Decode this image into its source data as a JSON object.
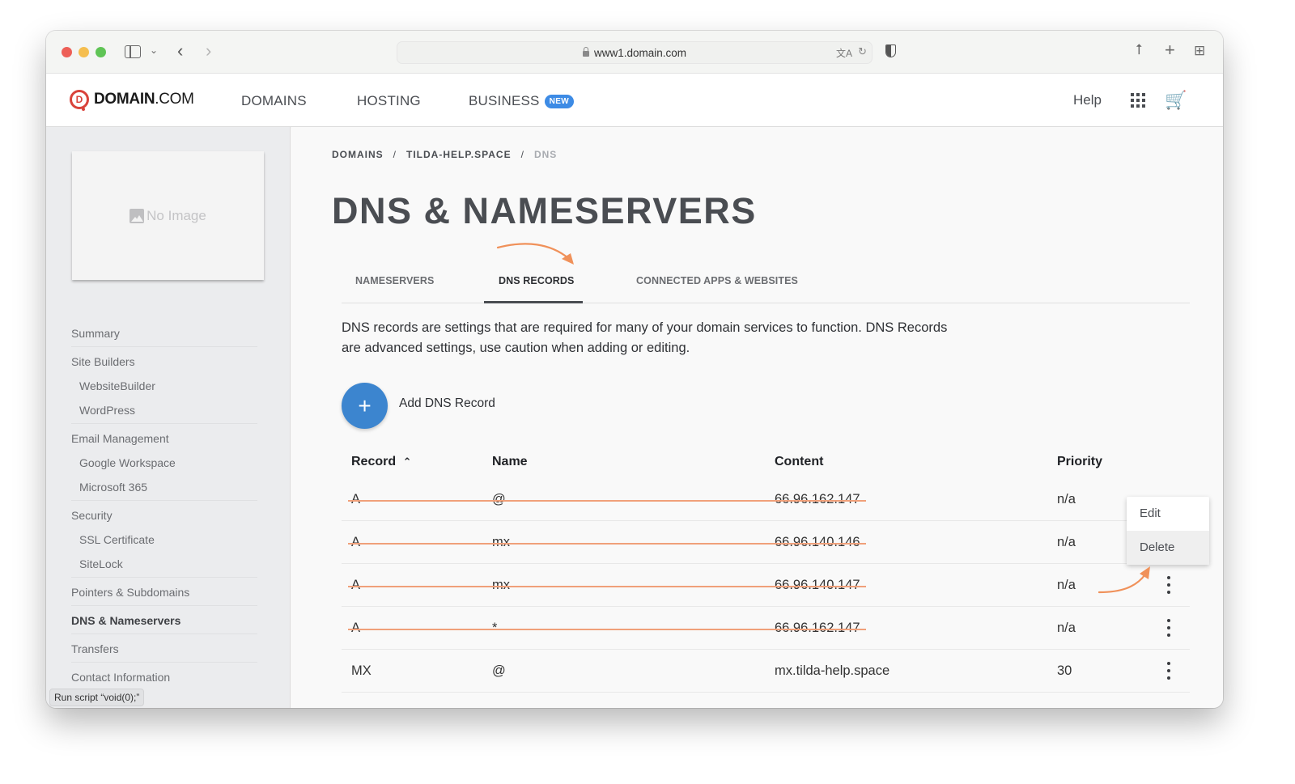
{
  "browser": {
    "url": "www1.domain.com",
    "icons": [
      "sidebar-icon",
      "chevron-down-icon",
      "back-icon",
      "forward-icon",
      "lock-icon",
      "translate-icon",
      "reload-icon",
      "privacy-shield-icon",
      "share-icon",
      "new-tab-icon",
      "tab-overview-icon"
    ]
  },
  "header": {
    "logo_bold": "DOMAIN",
    "logo_light": ".COM",
    "logo_mark": "D",
    "nav": [
      {
        "label": "DOMAINS"
      },
      {
        "label": "HOSTING"
      },
      {
        "label": "BUSINESS",
        "badge": "NEW"
      }
    ],
    "help_label": "Help",
    "badge_color": "#3d8be5"
  },
  "sidebar": {
    "image_placeholder": "No Image",
    "items": [
      {
        "label": "Summary",
        "level": 0
      },
      {
        "label": "Site Builders",
        "level": 0
      },
      {
        "label": "WebsiteBuilder",
        "level": 1
      },
      {
        "label": "WordPress",
        "level": 1
      },
      {
        "label": "Email Management",
        "level": 0
      },
      {
        "label": "Google Workspace",
        "level": 1
      },
      {
        "label": "Microsoft 365",
        "level": 1
      },
      {
        "label": "Security",
        "level": 0
      },
      {
        "label": "SSL Certificate",
        "level": 1
      },
      {
        "label": "SiteLock",
        "level": 1
      },
      {
        "label": "Pointers & Subdomains",
        "level": 0
      },
      {
        "label": "DNS & Nameservers",
        "level": 0,
        "active": true
      },
      {
        "label": "Transfers",
        "level": 0
      },
      {
        "label": "Contact Information",
        "level": 0
      }
    ],
    "status_tooltip": "Run script “void(0);”"
  },
  "main": {
    "breadcrumb": [
      "DOMAINS",
      "TILDA-HELP.SPACE",
      "DNS"
    ],
    "breadcrumb_sep": "/",
    "title": "DNS & NAMESERVERS",
    "tabs": [
      {
        "label": "NAMESERVERS"
      },
      {
        "label": "DNS RECORDS",
        "active": true
      },
      {
        "label": "CONNECTED APPS & WEBSITES"
      }
    ],
    "description": "DNS records are settings that are required for many of your domain services to function. DNS Records are advanced settings, use caution when adding or editing.",
    "add_button_icon": "+",
    "add_button_label": "Add DNS Record",
    "table": {
      "columns": [
        "Record",
        "Name",
        "Content",
        "Priority"
      ],
      "sort_column": "Record",
      "sort_direction": "ascending",
      "rows": [
        {
          "record": "A",
          "name": "@",
          "content": "66.96.162.147",
          "priority": "n/a",
          "struck": true
        },
        {
          "record": "A",
          "name": "mx",
          "content": "66.96.140.146",
          "priority": "n/a",
          "struck": true
        },
        {
          "record": "A",
          "name": "mx",
          "content": "66.96.140.147",
          "priority": "n/a",
          "struck": true
        },
        {
          "record": "A",
          "name": "*",
          "content": "66.96.162.147",
          "priority": "n/a",
          "struck": true
        },
        {
          "record": "MX",
          "name": "@",
          "content": "mx.tilda-help.space",
          "priority": "30",
          "struck": false
        }
      ]
    },
    "row_menu": {
      "items": [
        "Edit",
        "Delete"
      ],
      "hovered": "Delete"
    },
    "annotation_color": "#f0915a"
  }
}
